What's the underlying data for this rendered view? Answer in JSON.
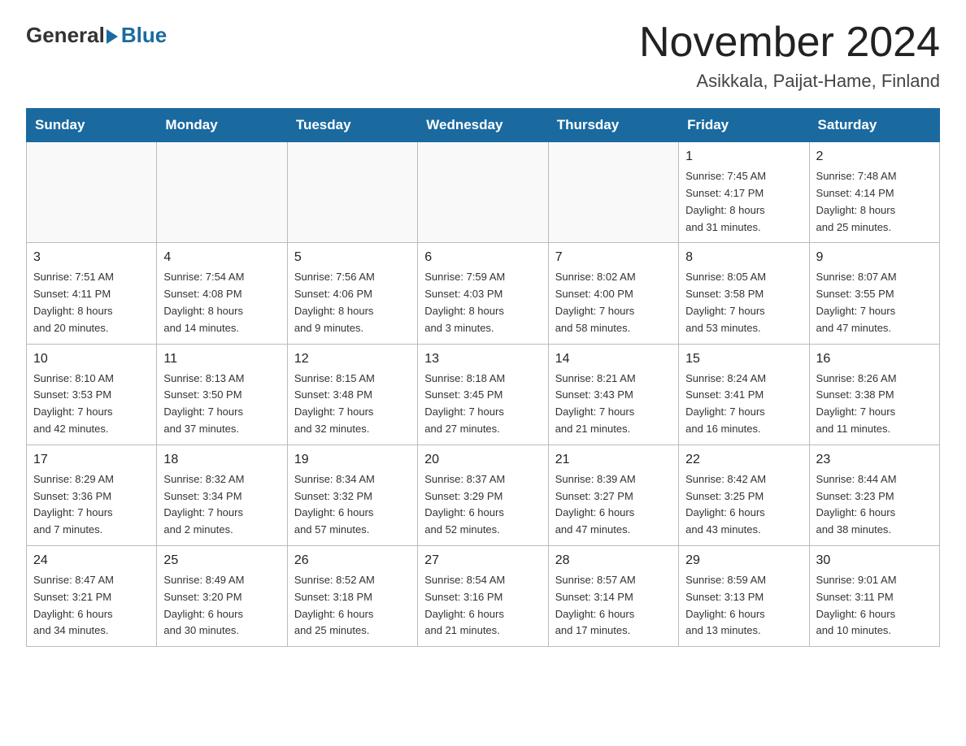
{
  "header": {
    "logo_general": "General",
    "logo_blue": "Blue",
    "month_title": "November 2024",
    "location": "Asikkala, Paijat-Hame, Finland"
  },
  "days_of_week": [
    "Sunday",
    "Monday",
    "Tuesday",
    "Wednesday",
    "Thursday",
    "Friday",
    "Saturday"
  ],
  "weeks": [
    {
      "days": [
        {
          "number": "",
          "info": ""
        },
        {
          "number": "",
          "info": ""
        },
        {
          "number": "",
          "info": ""
        },
        {
          "number": "",
          "info": ""
        },
        {
          "number": "",
          "info": ""
        },
        {
          "number": "1",
          "info": "Sunrise: 7:45 AM\nSunset: 4:17 PM\nDaylight: 8 hours\nand 31 minutes."
        },
        {
          "number": "2",
          "info": "Sunrise: 7:48 AM\nSunset: 4:14 PM\nDaylight: 8 hours\nand 25 minutes."
        }
      ]
    },
    {
      "days": [
        {
          "number": "3",
          "info": "Sunrise: 7:51 AM\nSunset: 4:11 PM\nDaylight: 8 hours\nand 20 minutes."
        },
        {
          "number": "4",
          "info": "Sunrise: 7:54 AM\nSunset: 4:08 PM\nDaylight: 8 hours\nand 14 minutes."
        },
        {
          "number": "5",
          "info": "Sunrise: 7:56 AM\nSunset: 4:06 PM\nDaylight: 8 hours\nand 9 minutes."
        },
        {
          "number": "6",
          "info": "Sunrise: 7:59 AM\nSunset: 4:03 PM\nDaylight: 8 hours\nand 3 minutes."
        },
        {
          "number": "7",
          "info": "Sunrise: 8:02 AM\nSunset: 4:00 PM\nDaylight: 7 hours\nand 58 minutes."
        },
        {
          "number": "8",
          "info": "Sunrise: 8:05 AM\nSunset: 3:58 PM\nDaylight: 7 hours\nand 53 minutes."
        },
        {
          "number": "9",
          "info": "Sunrise: 8:07 AM\nSunset: 3:55 PM\nDaylight: 7 hours\nand 47 minutes."
        }
      ]
    },
    {
      "days": [
        {
          "number": "10",
          "info": "Sunrise: 8:10 AM\nSunset: 3:53 PM\nDaylight: 7 hours\nand 42 minutes."
        },
        {
          "number": "11",
          "info": "Sunrise: 8:13 AM\nSunset: 3:50 PM\nDaylight: 7 hours\nand 37 minutes."
        },
        {
          "number": "12",
          "info": "Sunrise: 8:15 AM\nSunset: 3:48 PM\nDaylight: 7 hours\nand 32 minutes."
        },
        {
          "number": "13",
          "info": "Sunrise: 8:18 AM\nSunset: 3:45 PM\nDaylight: 7 hours\nand 27 minutes."
        },
        {
          "number": "14",
          "info": "Sunrise: 8:21 AM\nSunset: 3:43 PM\nDaylight: 7 hours\nand 21 minutes."
        },
        {
          "number": "15",
          "info": "Sunrise: 8:24 AM\nSunset: 3:41 PM\nDaylight: 7 hours\nand 16 minutes."
        },
        {
          "number": "16",
          "info": "Sunrise: 8:26 AM\nSunset: 3:38 PM\nDaylight: 7 hours\nand 11 minutes."
        }
      ]
    },
    {
      "days": [
        {
          "number": "17",
          "info": "Sunrise: 8:29 AM\nSunset: 3:36 PM\nDaylight: 7 hours\nand 7 minutes."
        },
        {
          "number": "18",
          "info": "Sunrise: 8:32 AM\nSunset: 3:34 PM\nDaylight: 7 hours\nand 2 minutes."
        },
        {
          "number": "19",
          "info": "Sunrise: 8:34 AM\nSunset: 3:32 PM\nDaylight: 6 hours\nand 57 minutes."
        },
        {
          "number": "20",
          "info": "Sunrise: 8:37 AM\nSunset: 3:29 PM\nDaylight: 6 hours\nand 52 minutes."
        },
        {
          "number": "21",
          "info": "Sunrise: 8:39 AM\nSunset: 3:27 PM\nDaylight: 6 hours\nand 47 minutes."
        },
        {
          "number": "22",
          "info": "Sunrise: 8:42 AM\nSunset: 3:25 PM\nDaylight: 6 hours\nand 43 minutes."
        },
        {
          "number": "23",
          "info": "Sunrise: 8:44 AM\nSunset: 3:23 PM\nDaylight: 6 hours\nand 38 minutes."
        }
      ]
    },
    {
      "days": [
        {
          "number": "24",
          "info": "Sunrise: 8:47 AM\nSunset: 3:21 PM\nDaylight: 6 hours\nand 34 minutes."
        },
        {
          "number": "25",
          "info": "Sunrise: 8:49 AM\nSunset: 3:20 PM\nDaylight: 6 hours\nand 30 minutes."
        },
        {
          "number": "26",
          "info": "Sunrise: 8:52 AM\nSunset: 3:18 PM\nDaylight: 6 hours\nand 25 minutes."
        },
        {
          "number": "27",
          "info": "Sunrise: 8:54 AM\nSunset: 3:16 PM\nDaylight: 6 hours\nand 21 minutes."
        },
        {
          "number": "28",
          "info": "Sunrise: 8:57 AM\nSunset: 3:14 PM\nDaylight: 6 hours\nand 17 minutes."
        },
        {
          "number": "29",
          "info": "Sunrise: 8:59 AM\nSunset: 3:13 PM\nDaylight: 6 hours\nand 13 minutes."
        },
        {
          "number": "30",
          "info": "Sunrise: 9:01 AM\nSunset: 3:11 PM\nDaylight: 6 hours\nand 10 minutes."
        }
      ]
    }
  ]
}
